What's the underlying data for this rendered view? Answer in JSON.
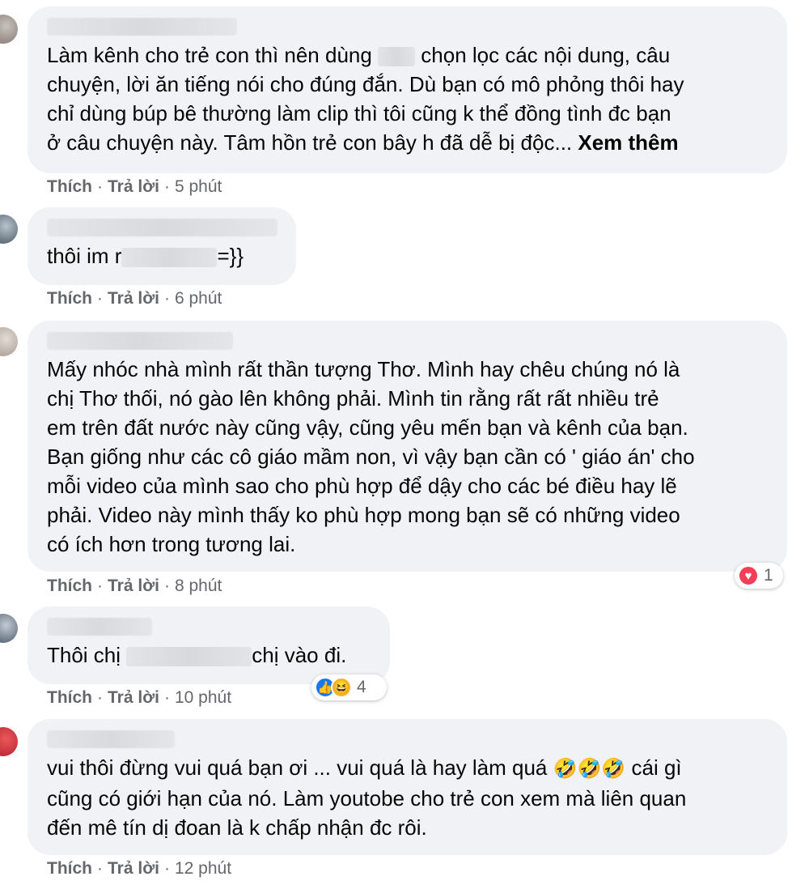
{
  "actions": {
    "like": "Thích",
    "reply": "Trả lời",
    "sep": "·"
  },
  "comments": [
    {
      "lines": [
        "Làm kênh cho trẻ con thì nên dùng ",
        " chọn lọc các nội dung, câu",
        "chuyện, lời ăn tiếng nói cho đúng đắn. Dù bạn có mô phỏng thôi hay",
        "chỉ dùng búp bê thường làm clip thì tôi cũng k thể đồng tình đc bạn",
        "ở câu chuyện này. Tâm hồn trẻ con bây h đã dễ bị độc... "
      ],
      "see_more": "Xem thêm",
      "time": "5 phút"
    },
    {
      "lines": [
        "thôi im r",
        "=}}"
      ],
      "time": "6 phút"
    },
    {
      "lines": [
        "Mấy nhóc nhà mình rất thần tượng Thơ. Mình hay chêu chúng nó là",
        "chị Thơ thối, nó gào lên không phải. Mình tin rằng rất rất nhiều trẻ",
        "em trên đất nước này cũng vậy, cũng yêu mến bạn và kênh của bạn.",
        "Bạn giống như các cô giáo mầm non, vì vậy bạn cần có ' giáo án' cho",
        "mỗi video của mình sao cho phù hợp để dậy cho các bé điều hay lẽ",
        "phải. Video này mình thấy ko phù hợp mong bạn sẽ có những video",
        "có ích hơn trong tương lai."
      ],
      "time": "8 phút",
      "reaction_count": "1",
      "reaction_icons": [
        "heart-icon"
      ]
    },
    {
      "lines": [
        "Thôi chị ",
        "chị vào đi."
      ],
      "time": "10 phút",
      "reaction_count": "4",
      "reaction_icons": [
        "like-icon",
        "haha-icon"
      ]
    },
    {
      "lines": [
        "vui thôi đừng vui quá bạn ơi ... vui quá là hay làm quá ",
        " cái gì",
        "cũng có giới hạn của nó. Làm youtobe cho trẻ con xem mà liên quan",
        "đến mê tín dị đoan là k chấp nhận đc rôi."
      ],
      "emoji": "🤣🤣🤣",
      "time": "12 phút"
    }
  ],
  "colors": {
    "bubble": "#f0f2f5",
    "meta": "#65676b",
    "text": "#050505",
    "heart": "#f33e58",
    "like": "#1877f2"
  }
}
